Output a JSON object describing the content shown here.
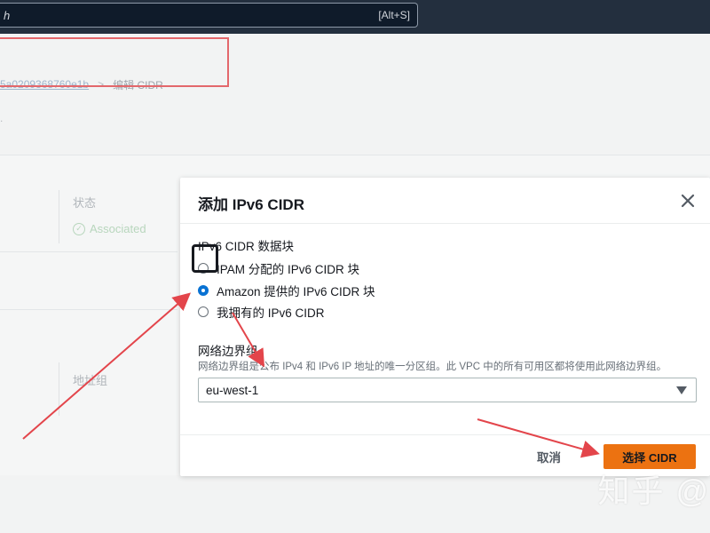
{
  "topbar": {
    "search_value": "h",
    "search_shortcut": "[Alt+S]"
  },
  "background": {
    "breadcrumb_link": "5a0209368760e1b",
    "breadcrumb_separator": ">",
    "breadcrumb_current": "编辑 CIDR",
    "dot_text": ".",
    "status_label": "状态",
    "status_value": "Associated",
    "address_label": "地址组"
  },
  "modal": {
    "title": "添加 IPv6 CIDR",
    "cidr_block_label": "IPv6 CIDR 数据块",
    "options": [
      {
        "label": "IPAM 分配的 IPv6 CIDR 块",
        "checked": false
      },
      {
        "label": "Amazon 提供的 IPv6 CIDR 块",
        "checked": true
      },
      {
        "label": "我拥有的 IPv6 CIDR",
        "checked": false
      }
    ],
    "border_group_label": "网络边界组",
    "border_group_desc": "网络边界组是公布 IPv4 和 IPv6 IP 地址的唯一分区组。此 VPC 中的所有可用区都将使用此网络边界组。",
    "border_group_value": "eu-west-1",
    "cancel_label": "取消",
    "confirm_label": "选择 CIDR"
  },
  "watermark": "知乎 @",
  "colors": {
    "accent_orange": "#ec7211",
    "radio_blue": "#0972d3",
    "annotation_red": "#e3454b",
    "topbar": "#232f3e"
  }
}
